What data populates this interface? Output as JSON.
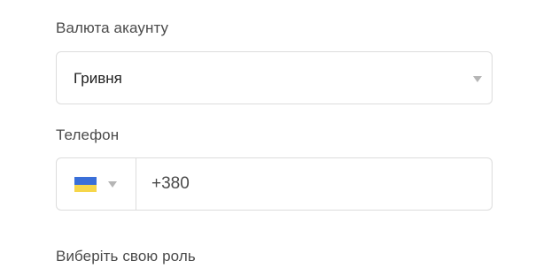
{
  "currency": {
    "label": "Валюта акаунту",
    "selected": "Гривня",
    "icon": "chevron-down-icon"
  },
  "phone": {
    "label": "Телефон",
    "country_flag": "ukraine-flag-icon",
    "flag_colors": [
      "#3a6fd8",
      "#f6d64a"
    ],
    "caret_icon": "chevron-down-icon",
    "value": "+380"
  },
  "role": {
    "label": "Виберіть свою роль"
  },
  "colors": {
    "border": "#dcdcdc",
    "label_text": "#4a4a4a",
    "caret": "#b5b5b5"
  }
}
